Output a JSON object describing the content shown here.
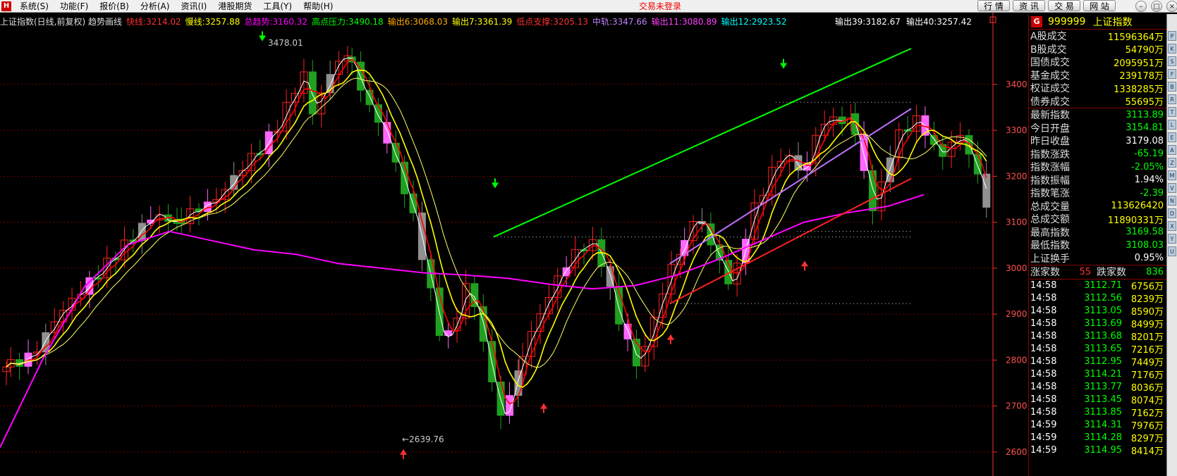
{
  "menubar": {
    "logo": "H",
    "items": [
      "系统(S)",
      "功能(F)",
      "报价(B)",
      "分析(A)",
      "资讯(I)",
      "港股期货",
      "工具(Y)",
      "帮助(H)"
    ],
    "login_status": "交易未登录",
    "buttons": [
      "行 情",
      "资 讯",
      "交 易",
      "网 站"
    ]
  },
  "chart_header": {
    "items": [
      {
        "text": "上证指数(日线,前复权) 趋势画线",
        "color": "#dddddd"
      },
      {
        "text": "快线:3214.02",
        "color": "#ff3030"
      },
      {
        "text": "慢线:3257.88",
        "color": "#ffff00"
      },
      {
        "text": "总趋势:3160.32",
        "color": "#ff00ff"
      },
      {
        "text": "高点压力:3490.18",
        "color": "#00ff00"
      },
      {
        "text": "输出6:3068.03",
        "color": "#ffaa00"
      },
      {
        "text": "输出7:3361.39",
        "color": "#ffff00"
      },
      {
        "text": "低点支撑:3205.13",
        "color": "#ff3030"
      },
      {
        "text": "中轨:3347.66",
        "color": "#c080ff"
      },
      {
        "text": "输出11:3080.89",
        "color": "#ff40ff"
      },
      {
        "text": "输出12:2923.52",
        "color": "#00ffff"
      }
    ],
    "right_items": [
      "输出39:3182.67",
      "输出40:3257.42"
    ]
  },
  "chart_data": {
    "type": "candlestick",
    "title": "上证指数(日线,前复权) 趋势画线",
    "ylim": [
      2560,
      3510
    ],
    "y_ticks": [
      2600,
      2700,
      2800,
      2900,
      3000,
      3100,
      3200,
      3300,
      3400
    ],
    "annotations": [
      {
        "text": "3478.01",
        "value": 3478.01,
        "kind": "high"
      },
      {
        "text": "←2639.76",
        "value": 2639.76,
        "kind": "low"
      }
    ],
    "colors": {
      "up": "#ff2020",
      "down": "#20a020",
      "up_alt": "#ff66ff",
      "gray": "#909090",
      "fast": "#ff0000",
      "slow": "#ffff00",
      "trend": "#ff00ff",
      "white": "#ffffff",
      "resist": "#00ff00",
      "support": "#ff2020",
      "mid": "#c070ff",
      "grid": "#700000",
      "axis": "#ff3030"
    }
  },
  "panel": {
    "code": "999999",
    "name": "上证指数",
    "rows1": [
      {
        "label": "A股成交",
        "value": "11596364万",
        "color": "#ffff00"
      },
      {
        "label": "B股成交",
        "value": "54790万",
        "color": "#ffff00"
      },
      {
        "label": "国债成交",
        "value": "2095951万",
        "color": "#ffff00"
      },
      {
        "label": "基金成交",
        "value": "239178万",
        "color": "#ffff00"
      },
      {
        "label": "权证成交",
        "value": "1338285万",
        "color": "#ffff00"
      },
      {
        "label": "债券成交",
        "value": "55695万",
        "color": "#ffff00"
      }
    ],
    "rows2": [
      {
        "label": "最新指数",
        "value": "3113.89",
        "color": "#00ff00"
      },
      {
        "label": "今日开盘",
        "value": "3154.81",
        "color": "#00ff00"
      },
      {
        "label": "昨日收盘",
        "value": "3179.08",
        "color": "#ffffff"
      },
      {
        "label": "指数涨跌",
        "value": "-65.19",
        "color": "#00ff00"
      },
      {
        "label": "指数涨幅",
        "value": "-2.05%",
        "color": "#00ff00"
      },
      {
        "label": "指数振幅",
        "value": "1.94%",
        "color": "#ffffff"
      },
      {
        "label": "指数笔涨",
        "value": "-2.39",
        "color": "#00ff00"
      },
      {
        "label": "总成交量",
        "value": "113626420",
        "color": "#ffff00"
      },
      {
        "label": "总成交额",
        "value": "11890331万",
        "color": "#ffff00"
      },
      {
        "label": "最高指数",
        "value": "3169.58",
        "color": "#00ff00"
      },
      {
        "label": "最低指数",
        "value": "3108.03",
        "color": "#00ff00"
      },
      {
        "label": "上证换手",
        "value": "0.95%",
        "color": "#ffffff"
      }
    ],
    "rise_label": "涨家数",
    "rise_count": "55",
    "fall_label": "跌家数",
    "fall_count": "836",
    "ticks": [
      {
        "time": "14:58",
        "price": "3112.71",
        "vol": "6756万"
      },
      {
        "time": "14:58",
        "price": "3112.56",
        "vol": "8239万"
      },
      {
        "time": "14:58",
        "price": "3113.05",
        "vol": "8590万"
      },
      {
        "time": "14:58",
        "price": "3113.69",
        "vol": "8499万"
      },
      {
        "time": "14:58",
        "price": "3113.68",
        "vol": "8201万"
      },
      {
        "time": "14:58",
        "price": "3113.65",
        "vol": "7216万"
      },
      {
        "time": "14:58",
        "price": "3112.95",
        "vol": "7449万"
      },
      {
        "time": "14:58",
        "price": "3114.21",
        "vol": "7176万"
      },
      {
        "time": "14:58",
        "price": "3113.77",
        "vol": "8036万"
      },
      {
        "time": "14:58",
        "price": "3113.45",
        "vol": "8074万"
      },
      {
        "time": "14:58",
        "price": "3113.85",
        "vol": "7162万"
      },
      {
        "time": "14:59",
        "price": "3114.31",
        "vol": "7976万"
      },
      {
        "time": "14:59",
        "price": "3114.28",
        "vol": "8297万"
      },
      {
        "time": "14:59",
        "price": "3114.95",
        "vol": "8414万"
      }
    ]
  }
}
